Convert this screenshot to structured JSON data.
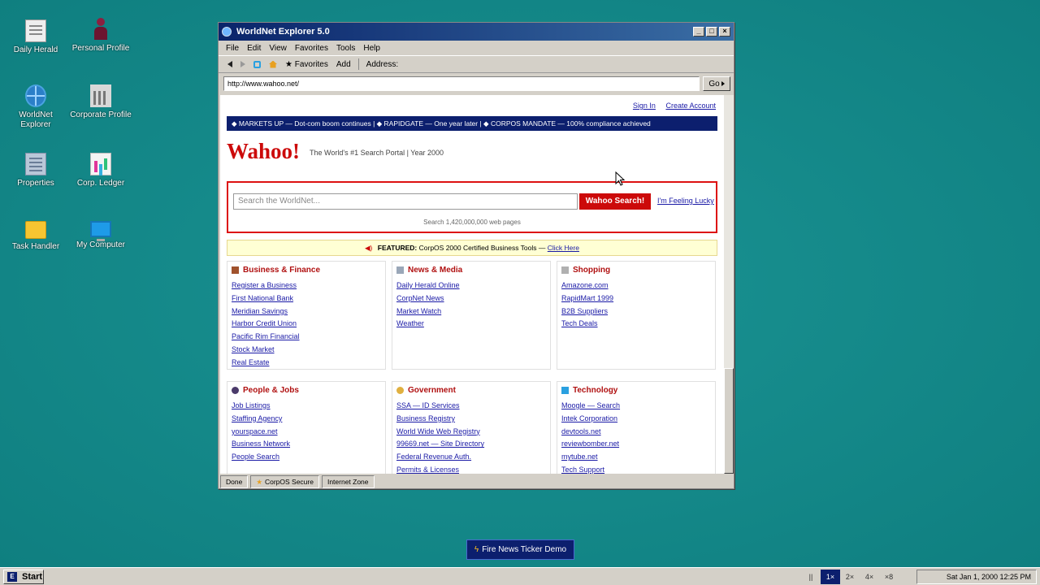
{
  "desktop": {
    "icons": [
      {
        "label": "Daily Herald",
        "icon": "newspaper-icon"
      },
      {
        "label": "Personal Profile",
        "icon": "person-icon"
      },
      {
        "label": "WorldNet Explorer",
        "icon": "globe-icon"
      },
      {
        "label": "Corporate Profile",
        "icon": "bank-icon"
      },
      {
        "label": "Properties",
        "icon": "building-icon"
      },
      {
        "label": "Corp. Ledger",
        "icon": "ledger-chart-icon"
      },
      {
        "label": "Task Handler",
        "icon": "folder-icon"
      },
      {
        "label": "My Computer",
        "icon": "monitor-icon"
      }
    ]
  },
  "browser": {
    "title": "WorldNet Explorer 5.0",
    "menu": [
      "File",
      "Edit",
      "View",
      "Favorites",
      "Tools",
      "Help"
    ],
    "toolbar": {
      "favorites": "★ Favorites",
      "add": "Add",
      "address_label": "Address:"
    },
    "address": "http://www.wahoo.net/",
    "go": "Go",
    "status": {
      "done": "Done",
      "secure": "CorpOS Secure",
      "zone": "Internet Zone"
    }
  },
  "page": {
    "sign_in": "Sign In",
    "create_account": "Create Account",
    "ticker": "◆ MARKETS UP — Dot-com boom continues  |  ◆ RAPIDGATE — One year later  |  ◆ CORPOS MANDATE — 100% compliance achieved",
    "logo": "Wahoo!",
    "tagline": "The World's #1 Search Portal  |  Year 2000",
    "search_placeholder": "Search the WorldNet...",
    "search_button": "Wahoo Search!",
    "lucky": "I'm Feeling Lucky",
    "search_count": "Search 1,420,000,000 web pages",
    "featured_label": "FEATURED:",
    "featured_text": "CorpOS 2000 Certified Business Tools —",
    "featured_link": "Click Here",
    "categories": [
      {
        "title": "Business & Finance",
        "links": [
          "Register a Business",
          "First National Bank",
          "Meridian Savings",
          "Harbor Credit Union",
          "Pacific Rim Financial",
          "Stock Market",
          "Real Estate"
        ]
      },
      {
        "title": "News & Media",
        "links": [
          "Daily Herald Online",
          "CorpNet News",
          "Market Watch",
          "Weather"
        ]
      },
      {
        "title": "Shopping",
        "links": [
          "Amazone.com",
          "RapidMart 1999",
          "B2B Suppliers",
          "Tech Deals"
        ]
      },
      {
        "title": "People & Jobs",
        "links": [
          "Job Listings",
          "Staffing Agency",
          "yourspace.net",
          "Business Network",
          "People Search"
        ]
      },
      {
        "title": "Government",
        "links": [
          "SSA — ID Services",
          "Business Registry",
          "World Wide Web Registry",
          "99669.net — Site Directory",
          "Federal Revenue Auth.",
          "Permits & Licenses"
        ]
      },
      {
        "title": "Technology",
        "links": [
          "Moogle — Search",
          "Intek Corporation",
          "devtools.net",
          "reviewbomber.net",
          "mytube.net",
          "Tech Support"
        ]
      }
    ]
  },
  "demo_button": "Fire News Ticker Demo",
  "taskbar": {
    "start": "Start",
    "speeds": [
      "||",
      "1×",
      "2×",
      "4×",
      "×8"
    ],
    "clock": "Sat Jan 1, 2000 12:25 PM"
  },
  "colors": {
    "desktop": "#138a8a",
    "brand_red": "#cc0a0a",
    "navy": "#0c1f6e",
    "link": "#1a1aa6"
  }
}
